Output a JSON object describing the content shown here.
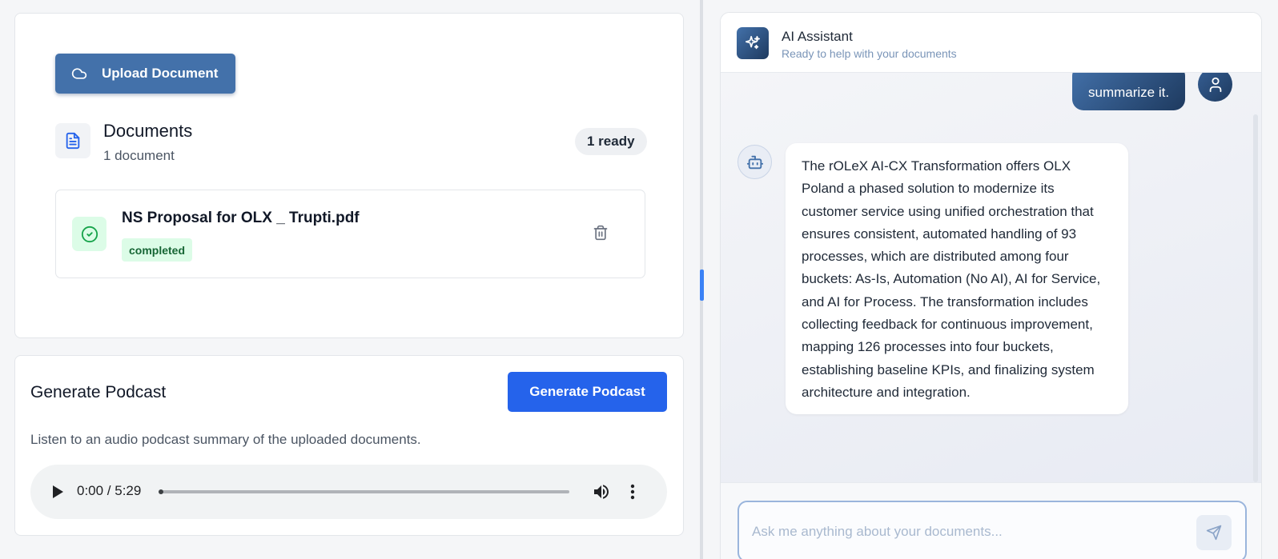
{
  "documents_panel": {
    "upload_label": "Upload Document",
    "title": "Documents",
    "count_text": "1 document",
    "ready_badge": "1 ready",
    "items": [
      {
        "name": "NS Proposal for OLX _ Trupti.pdf",
        "status": "completed"
      }
    ]
  },
  "podcast_panel": {
    "title": "Generate Podcast",
    "button_label": "Generate Podcast",
    "description": "Listen to an audio podcast summary of the uploaded documents.",
    "player": {
      "time_display": "0:00 / 5:29",
      "progress": 0.0
    }
  },
  "chat": {
    "assistant_name": "AI Assistant",
    "assistant_status": "Ready to help with your documents",
    "messages": [
      {
        "role": "user",
        "text": "summarize it."
      },
      {
        "role": "assistant",
        "text": "The rOLeX AI-CX Transformation offers OLX Poland a phased solution to modernize its customer service using unified orchestration that ensures consistent, automated handling of 93 processes, which are distributed among four buckets: As-Is, Automation (No AI), AI for Service, and AI for Process. The transformation includes collecting feedback for continuous improvement, mapping 126 processes into four buckets, establishing baseline KPIs, and finalizing system architecture and integration."
      }
    ],
    "input_placeholder": "Ask me anything about your documents..."
  },
  "icons": {
    "upload": "cloud-icon",
    "documents": "file-text-icon",
    "doc_status": "check-circle-icon",
    "delete": "trash-icon",
    "assistant": "sparkles-icon",
    "user": "user-icon",
    "bot": "bot-icon",
    "send": "send-icon"
  },
  "colors": {
    "primary_steel": "#4371aa",
    "primary_blue": "#2563eb",
    "success_bg": "#dcfce7",
    "success_text": "#166534"
  }
}
